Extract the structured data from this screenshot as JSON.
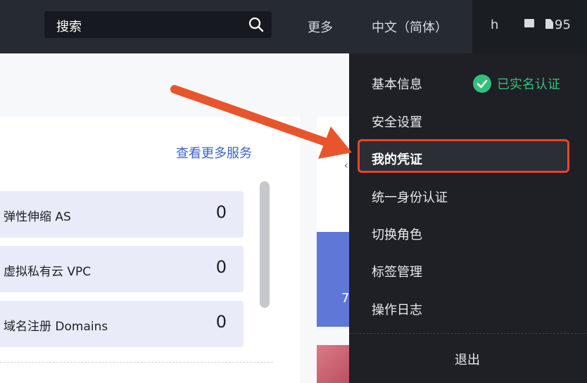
{
  "header": {
    "search_placeholder": "搜索",
    "nav_more": "更多",
    "nav_language": "中文（简体）",
    "user_initial": "h",
    "badge_count": "95"
  },
  "main": {
    "more_services_link": "查看更多服务",
    "services": [
      {
        "label": "弹性伸缩 AS",
        "count": "0"
      },
      {
        "label": "虚拟私有云 VPC",
        "count": "0"
      },
      {
        "label": "域名注册 Domains",
        "count": "0"
      }
    ],
    "right_card_number": "7"
  },
  "user_menu": {
    "items": [
      {
        "label": "基本信息"
      },
      {
        "label": "安全设置"
      },
      {
        "label": "我的凭证"
      },
      {
        "label": "统一身份认证"
      },
      {
        "label": "切换角色"
      },
      {
        "label": "标签管理"
      },
      {
        "label": "操作日志"
      }
    ],
    "verified_status": "已实名认证",
    "logout_label": "退出",
    "highlight_color": "#e8442c",
    "verified_color": "#33c07b"
  }
}
